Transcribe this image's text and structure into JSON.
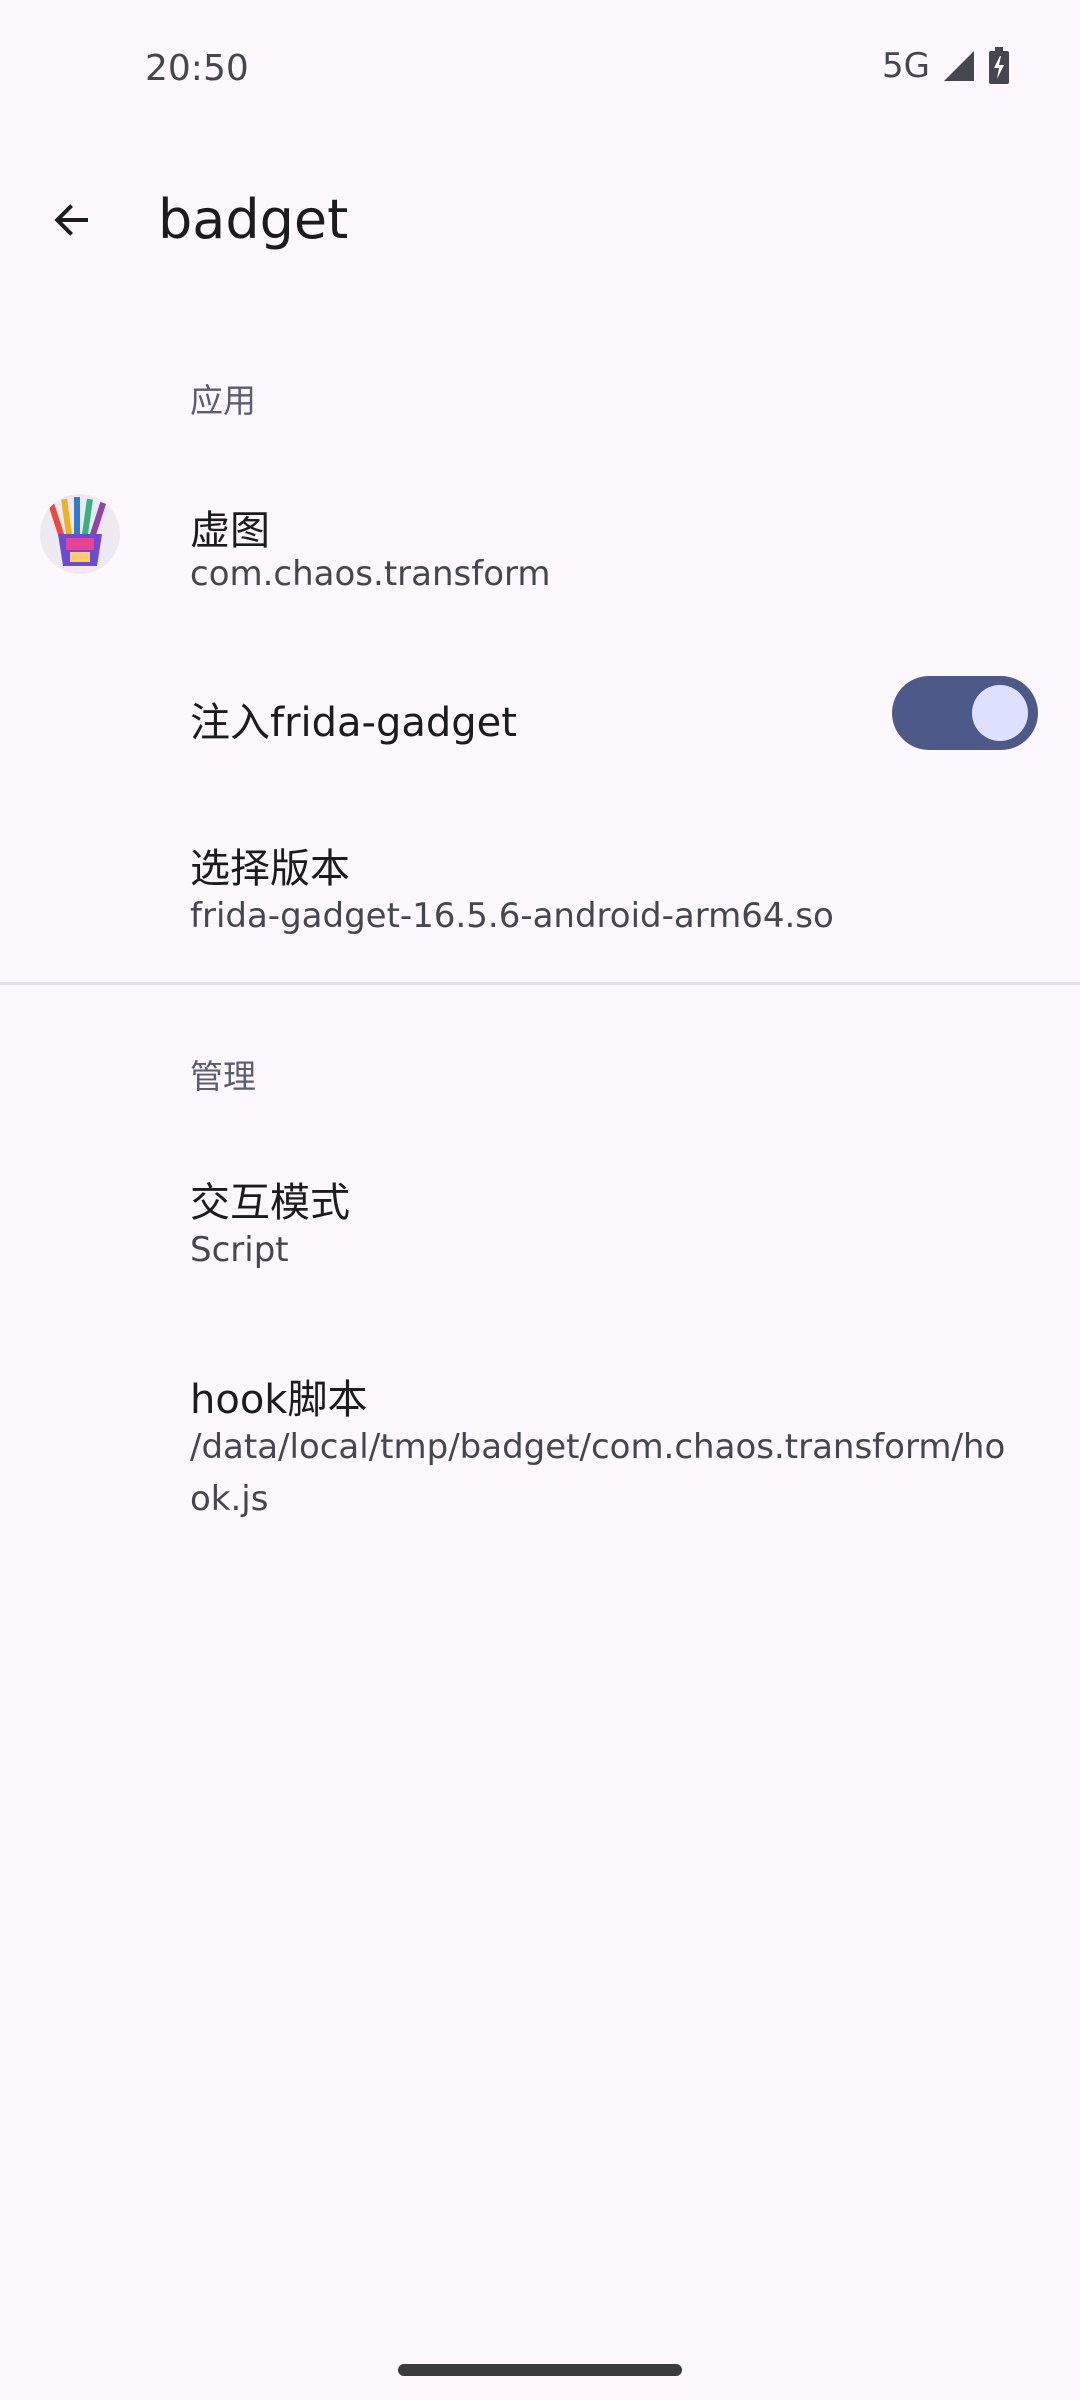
{
  "status_bar": {
    "time": "20:50",
    "network": "5G",
    "signal_icon": "cellular-signal-icon",
    "battery_icon": "battery-charging-icon"
  },
  "top_bar": {
    "back_icon": "arrow-back-icon",
    "title": "badget"
  },
  "sections": {
    "app": {
      "header": "应用",
      "app_item": {
        "title": "虚图",
        "summary": "com.chaos.transform",
        "icon": "app-icon"
      },
      "inject_item": {
        "title": "注入frida-gadget",
        "switch_on": true
      },
      "version_item": {
        "title": "选择版本",
        "summary": "frida-gadget-16.5.6-android-arm64.so"
      }
    },
    "manage": {
      "header": "管理",
      "mode_item": {
        "title": "交互模式",
        "summary": "Script"
      },
      "hook_item": {
        "title": "hook脚本",
        "summary": "/data/local/tmp/badget/com.chaos.transform/hook.js"
      }
    }
  },
  "colors": {
    "background": "#fdf8fd",
    "switch_track": "#4d5988",
    "switch_thumb": "#dde1ff",
    "section_header": "#5b5d72"
  }
}
